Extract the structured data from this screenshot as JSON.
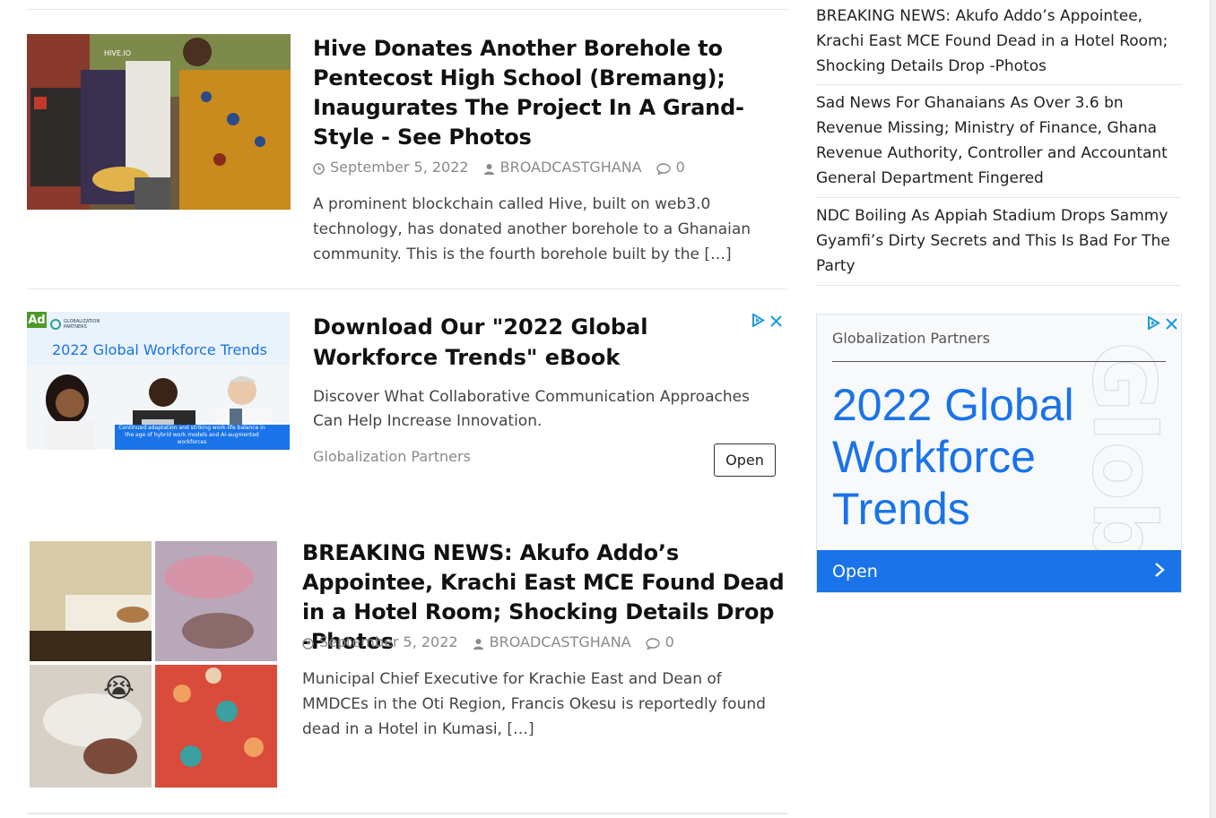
{
  "articles": [
    {
      "title": "Hive Donates Another Borehole to Pentecost High School (Bremang); Inaugurates The Project In A Grand-Style - See Photos",
      "date": "September 5, 2022",
      "author": "BROADCASTGHANA",
      "comments": "0",
      "excerpt": "A prominent blockchain called Hive, built on web3.0 technology, has donated another borehole to a Ghanaian community. This is the fourth borehole built by the",
      "more": "[…]",
      "image_label": "HIVE.IO"
    },
    {
      "title": "BREAKING NEWS: Akufo Addo’s Appointee, Krachi East MCE Found Dead in a Hotel Room; Shocking Details Drop -Photos",
      "date": "September 5, 2022",
      "author": "BROADCASTGHANA",
      "comments": "0",
      "excerpt": "Municipal Chief Executive for Krachie East and Dean of MMDCEs in the Oti Region, Francis Okesu is reportedly found dead in a Hotel in Kumasi,",
      "more": "[…]",
      "emoji": "😭"
    }
  ],
  "inline_ad": {
    "badge": "Ad",
    "image_brand": "GLOBALIZATION PARTNERS",
    "image_headline": "2022 Global Workforce Trends",
    "image_caption": "Continued adaptation and striking work-life balance in the age of hybrid work models and AI-augmented workforces",
    "title": "Download Our \"2022 Global Workforce Trends\" eBook",
    "body": "Discover What Collaborative Communication Approaches Can Help Increase Innovation.",
    "sponsor": "Globalization Partners",
    "open_label": "Open",
    "accent": "#1a73e8"
  },
  "sidebar": {
    "links": [
      "BREAKING NEWS: Akufo Addo’s Appointee, Krachi East MCE Found Dead in a Hotel Room; Shocking Details Drop -Photos",
      "Sad News For Ghanaians As Over 3.6 bn Revenue Missing; Ministry of Finance, Ghana Revenue Authority, Controller and Accountant General Department Fingered",
      "NDC Boiling As Appiah Stadium Drops Sammy Gyamfi’s Dirty Secrets and This Is Bad For The Party"
    ],
    "ad": {
      "sponsor": "Globalization Partners",
      "headline": "2022 Global Workforce Trends",
      "open_label": "Open",
      "accent": "#1a73e8"
    }
  }
}
